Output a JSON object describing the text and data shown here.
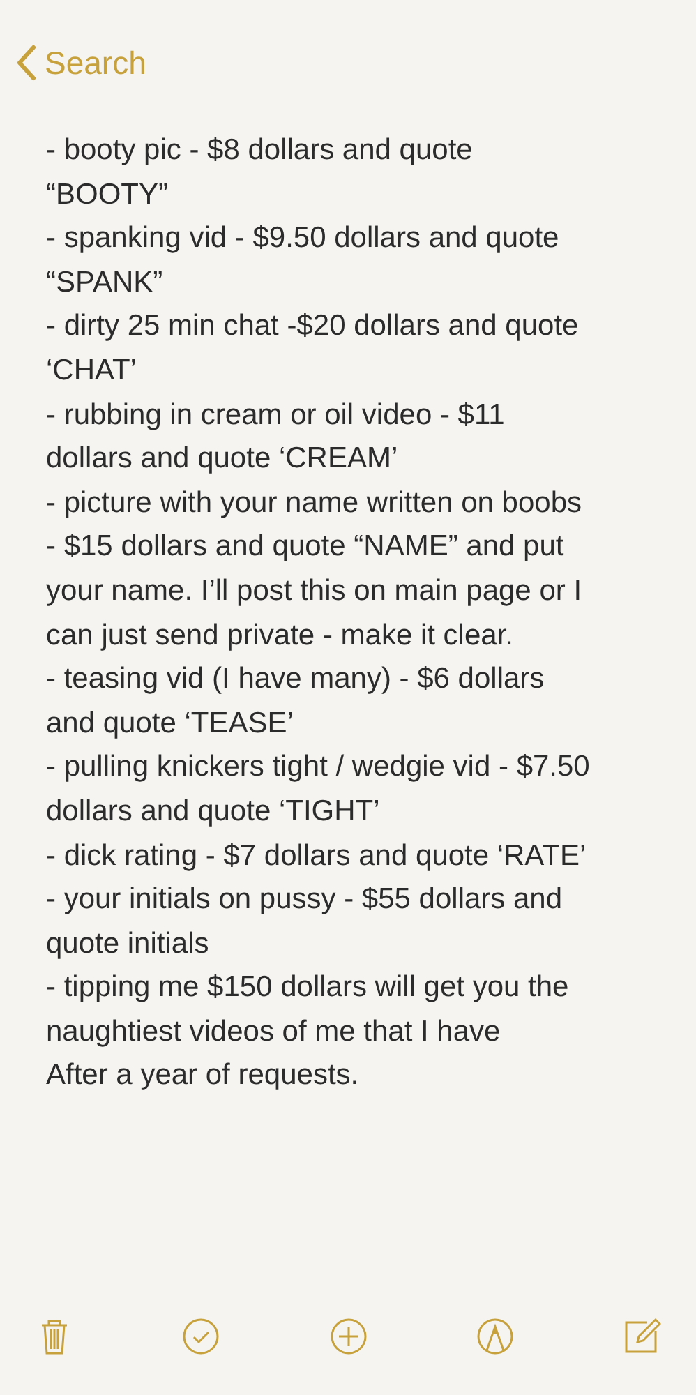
{
  "nav": {
    "back_label": "Search"
  },
  "note_lines": [
    "- booty pic - $8 dollars and quote",
    "“BOOTY”",
    "- spanking vid - $9.50 dollars and quote",
    "“SPANK”",
    "- dirty 25 min chat -$20 dollars and quote",
    "‘CHAT’",
    "- rubbing in cream or oil video - $11",
    "dollars and quote ‘CREAM’",
    "- picture with your name written on boobs",
    "- $15 dollars and quote “NAME” and put",
    "your name. I’ll post this on main page or I",
    "can just send private - make it clear.",
    "- teasing vid (I have many) - $6 dollars",
    "and quote ‘TEASE’",
    "- pulling knickers tight / wedgie vid - $7.50",
    "dollars and quote ‘TIGHT’",
    "- dick rating - $7 dollars and quote ‘RATE’",
    "- your initials on pussy - $55 dollars and",
    "quote initials",
    "- tipping me $150 dollars will get you the",
    "naughtiest videos of me that I have",
    "After a year of requests."
  ],
  "toolbar": [
    {
      "kind": "trash"
    },
    {
      "kind": "checklist"
    },
    {
      "kind": "add"
    },
    {
      "kind": "markup"
    },
    {
      "kind": "compose"
    }
  ]
}
